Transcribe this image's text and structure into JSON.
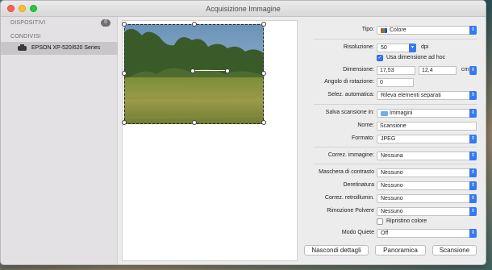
{
  "window": {
    "title": "Acquisizione Immagine"
  },
  "sidebar": {
    "devices_header": "DISPOSITIVI",
    "devices_count": "0",
    "shared_header": "CONDIVISI",
    "items": [
      {
        "label": "EPSON XP-520/620 Series",
        "icon": "printer-icon"
      }
    ]
  },
  "settings": {
    "tipo": {
      "label": "Tipo:",
      "value": "Colore"
    },
    "risoluzione": {
      "label": "Risoluzione:",
      "value": "50",
      "unit": "dpi"
    },
    "usa_dimensione": {
      "label": "Usa dimensione ad hoc",
      "checked": true
    },
    "dimensione": {
      "label": "Dimensione:",
      "width": "17,53",
      "height": "12,4",
      "unit": "cm"
    },
    "angolo": {
      "label": "Angolo di rotazione:",
      "value": "0"
    },
    "selez_automatica": {
      "label": "Selez. automatica:",
      "value": "Rileva elementi separati"
    },
    "salva_scansione": {
      "label": "Salva scansione in:",
      "value": "Immagini"
    },
    "nome": {
      "label": "Nome:",
      "value": "Scansione"
    },
    "formato": {
      "label": "Formato:",
      "value": "JPEG"
    },
    "correz_immagine": {
      "label": "Correz. immagine:",
      "value": "Nessuna"
    },
    "maschera_contrasto": {
      "label": "Maschera di contrasto",
      "value": "Nessuno"
    },
    "deretinatura": {
      "label": "Deretinatura",
      "value": "Nessuno"
    },
    "correz_retroillum": {
      "label": "Correz. retroillumin.",
      "value": "Nessuno"
    },
    "rimozione_polvere": {
      "label": "Rimozione Polvere",
      "value": "Nessuno"
    },
    "ripristino_colore": {
      "label": "Ripristino colore",
      "checked": false
    },
    "modo_quiete": {
      "label": "Modo Quiete",
      "value": "Off"
    }
  },
  "buttons": {
    "hide_details": "Nascondi dettagli",
    "overview": "Panoramica",
    "scan": "Scansione"
  },
  "colors": {
    "accent": "#3478f6",
    "selected_row": "#c9c6c9"
  }
}
